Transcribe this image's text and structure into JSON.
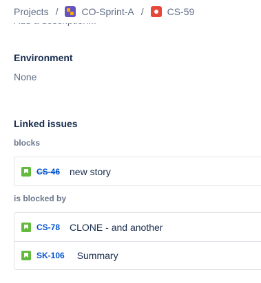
{
  "breadcrumb": {
    "projects": "Projects",
    "separator": "/",
    "project": "CO-Sprint-A",
    "issue": "CS-59"
  },
  "description_placeholder": "Add a description...",
  "environment": {
    "heading": "Environment",
    "value": "None"
  },
  "linked_issues": {
    "heading": "Linked issues",
    "groups": [
      {
        "label": "blocks",
        "items": [
          {
            "key": "CS-46",
            "summary": "new story",
            "type_icon": "story-icon",
            "resolved": true
          }
        ]
      },
      {
        "label": "is blocked by",
        "items": [
          {
            "key": "CS-78",
            "summary": "CLONE - and another",
            "type_icon": "story-icon",
            "resolved": false
          },
          {
            "key": "SK-106",
            "summary": "Summary",
            "type_icon": "story-icon",
            "resolved": false
          }
        ]
      }
    ]
  },
  "colors": {
    "link": "#0052cc",
    "story": "#63ba3c",
    "bug": "#e5493a",
    "project": "#6554c0"
  }
}
